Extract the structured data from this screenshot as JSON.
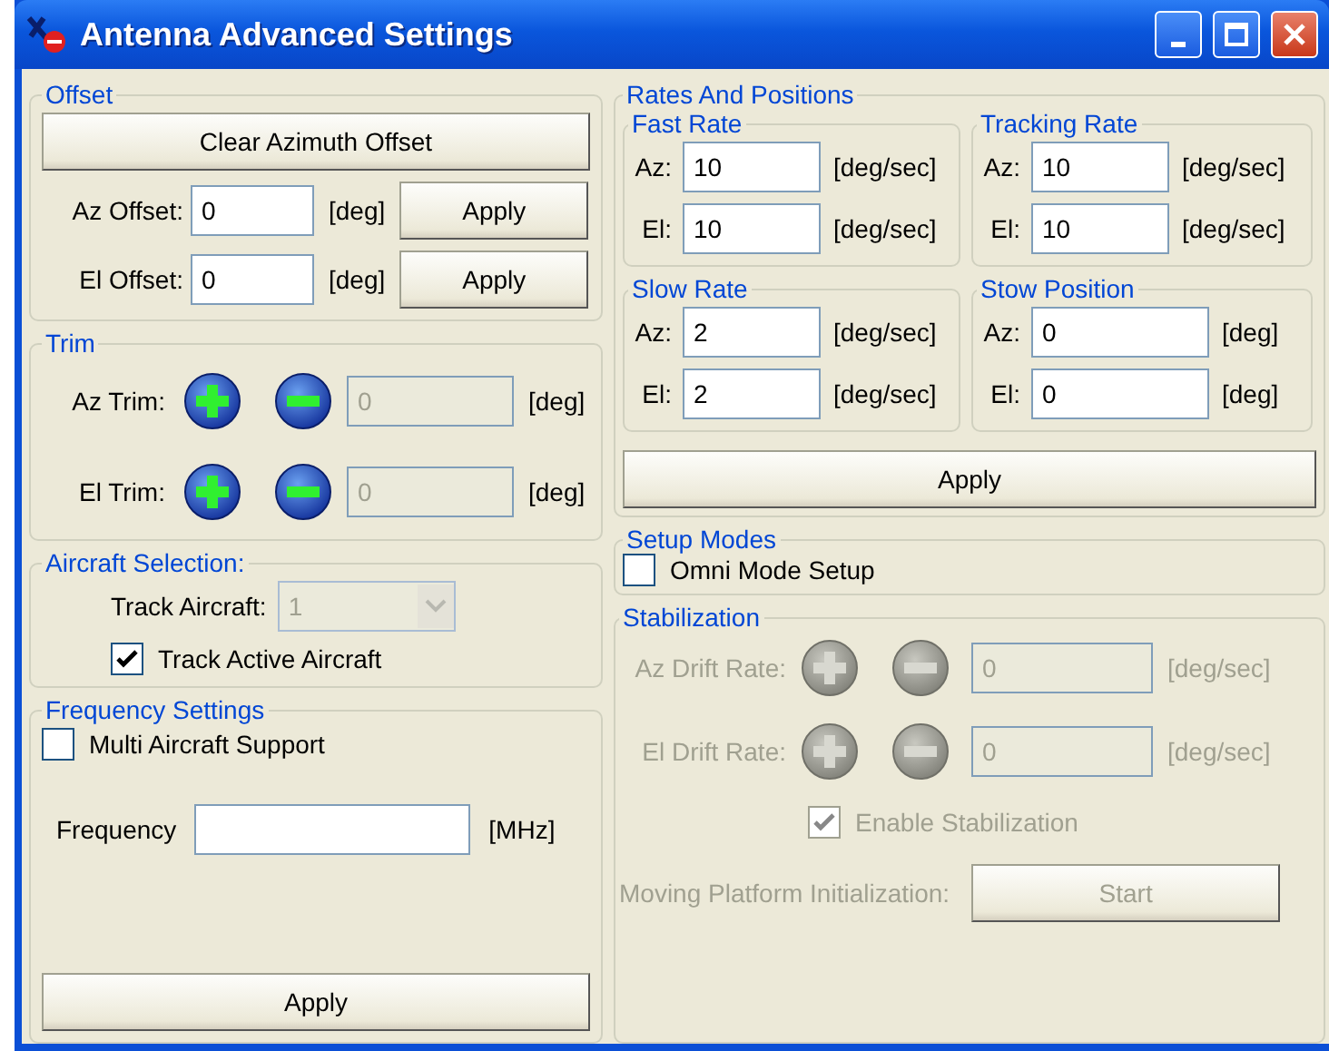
{
  "window": {
    "title": "Antenna Advanced Settings"
  },
  "offset": {
    "title": "Offset",
    "clear_button": "Clear Azimuth Offset",
    "rows": [
      {
        "label": "Az Offset:",
        "value": "0",
        "unit": "[deg]",
        "button": "Apply"
      },
      {
        "label": "El Offset:",
        "value": "0",
        "unit": "[deg]",
        "button": "Apply"
      }
    ]
  },
  "trim": {
    "title": "Trim",
    "rows": [
      {
        "label": "Az Trim:",
        "value": "0",
        "unit": "[deg]",
        "disabled": true
      },
      {
        "label": "El Trim:",
        "value": "0",
        "unit": "[deg]",
        "disabled": true
      }
    ]
  },
  "aircraft_selection": {
    "title": "Aircraft Selection:",
    "track_label": "Track Aircraft:",
    "track_value": "1",
    "track_disabled": true,
    "track_active": {
      "label": "Track Active Aircraft",
      "checked": true
    }
  },
  "frequency": {
    "title": "Frequency Settings",
    "multi": {
      "label": "Multi Aircraft Support",
      "checked": false
    },
    "label": "Frequency",
    "unit": "[MHz]",
    "button": "Apply"
  },
  "rates": {
    "title": "Rates And Positions",
    "groups": [
      {
        "title": "Fast Rate",
        "rows": [
          {
            "label": "Az:",
            "value": "10",
            "unit": "[deg/sec]"
          },
          {
            "label": "El:",
            "value": "10",
            "unit": "[deg/sec]"
          }
        ]
      },
      {
        "title": "Tracking Rate",
        "rows": [
          {
            "label": "Az:",
            "value": "10",
            "unit": "[deg/sec]"
          },
          {
            "label": "El:",
            "value": "10",
            "unit": "[deg/sec]"
          }
        ]
      },
      {
        "title": "Slow Rate",
        "rows": [
          {
            "label": "Az:",
            "value": "2",
            "unit": "[deg/sec]"
          },
          {
            "label": "El:",
            "value": "2",
            "unit": "[deg/sec]"
          }
        ]
      },
      {
        "title": "Stow Position",
        "rows": [
          {
            "label": "Az:",
            "value": "0",
            "unit": "[deg]"
          },
          {
            "label": "El:",
            "value": "0",
            "unit": "[deg]"
          }
        ]
      }
    ],
    "button": "Apply"
  },
  "setup_modes": {
    "title": "Setup Modes",
    "omni": {
      "label": "Omni Mode Setup",
      "checked": false
    }
  },
  "stabilization": {
    "title": "Stabilization",
    "disabled": true,
    "rows": [
      {
        "label": "Az Drift Rate:",
        "value": "0",
        "unit": "[deg/sec]"
      },
      {
        "label": "El Drift Rate:",
        "value": "0",
        "unit": "[deg/sec]"
      }
    ],
    "enable": {
      "label": "Enable Stabilization",
      "checked": true
    },
    "platform_label": "Moving Platform Initialization:",
    "start_button": "Start"
  }
}
